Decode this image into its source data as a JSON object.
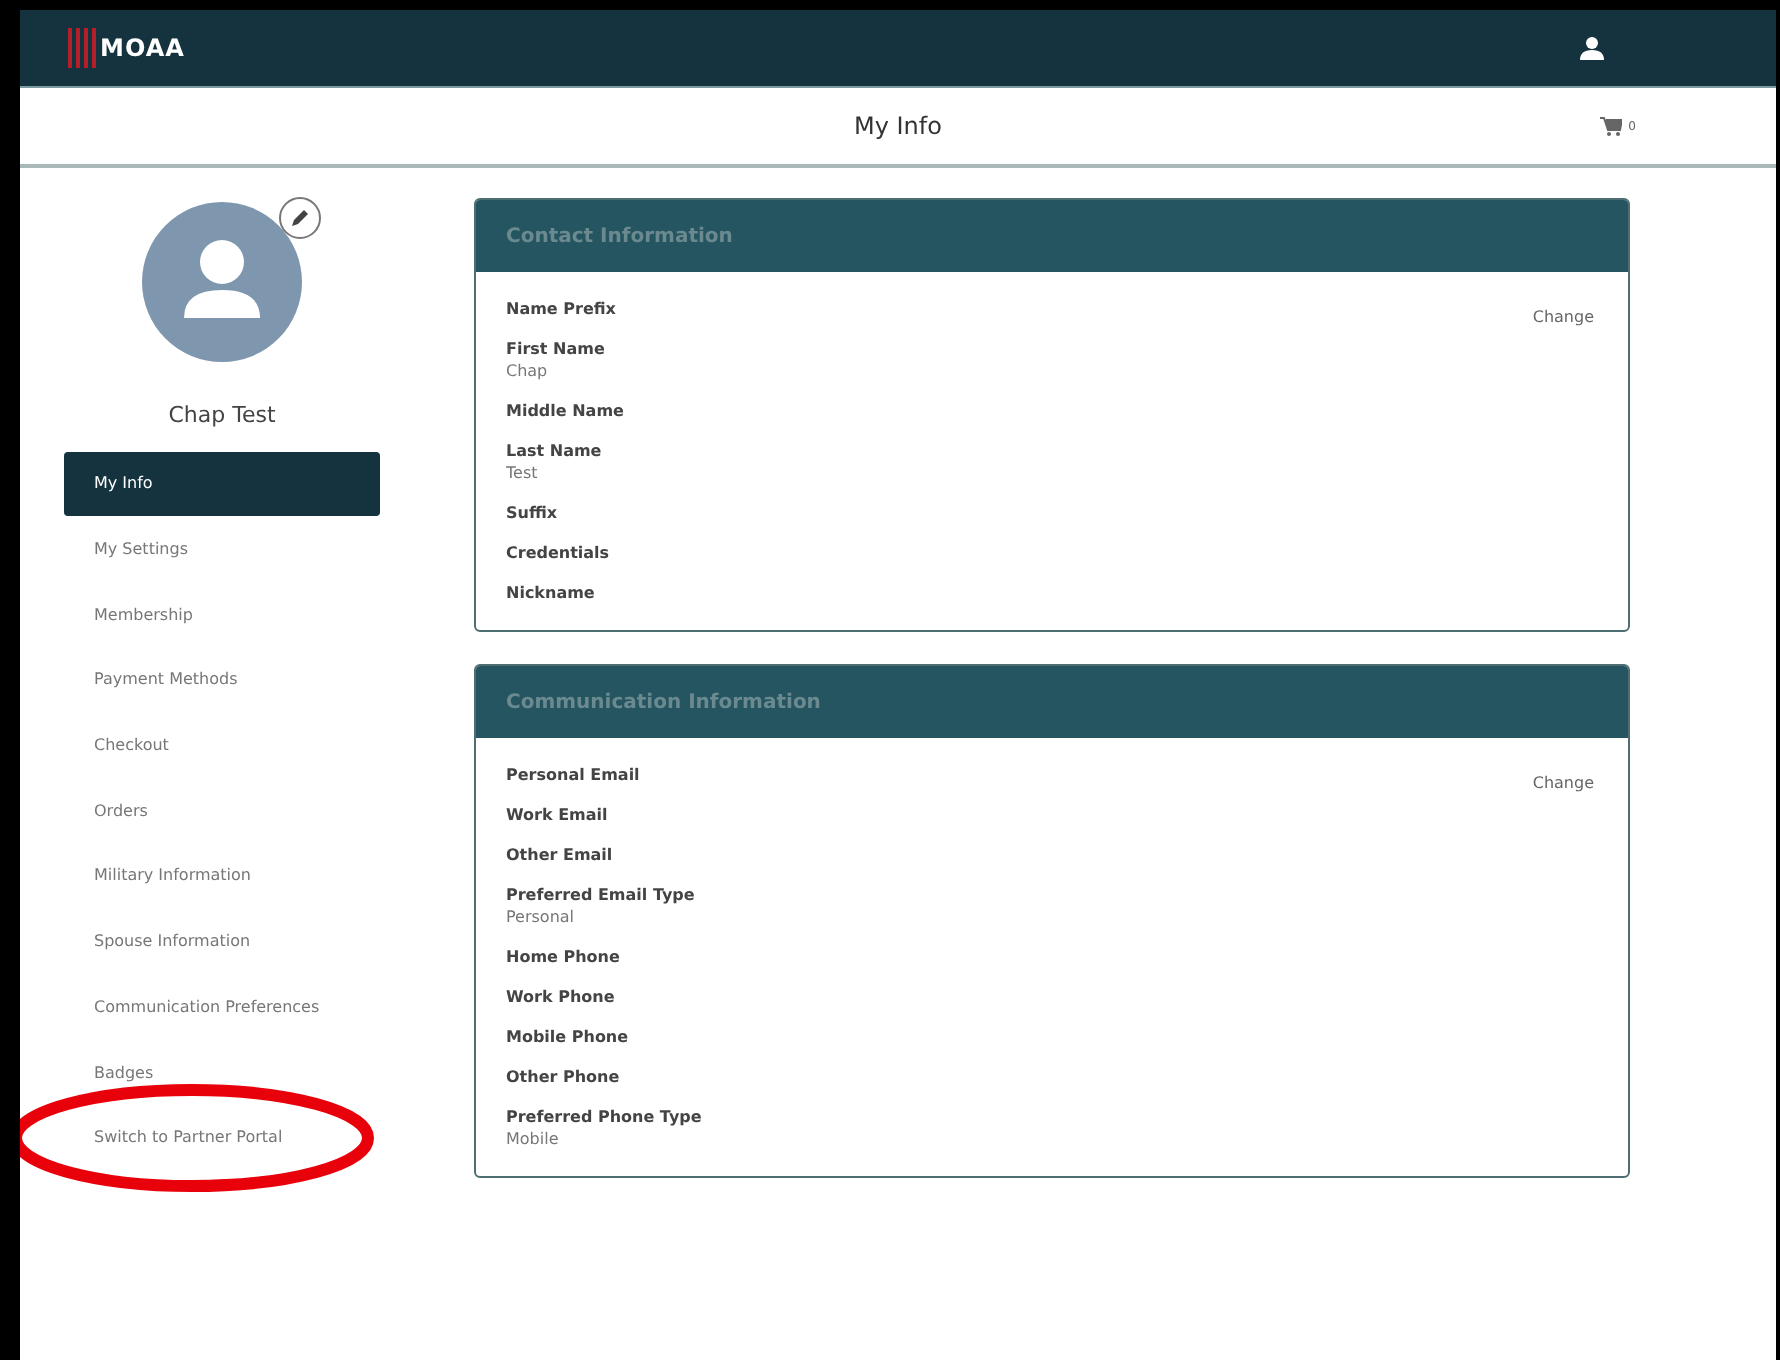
{
  "header": {
    "logo": "MOAA"
  },
  "subheader": {
    "title": "My Info",
    "cart_count": "0"
  },
  "profile": {
    "name": "Chap Test"
  },
  "sidebar": {
    "items": [
      {
        "label": "My Info",
        "selected": true
      },
      {
        "label": "My Settings",
        "selected": false
      },
      {
        "label": "Membership",
        "selected": false
      },
      {
        "label": "Payment Methods",
        "selected": false
      },
      {
        "label": "Checkout",
        "selected": false
      },
      {
        "label": "Orders",
        "selected": false
      },
      {
        "label": "Military Information",
        "selected": false
      },
      {
        "label": "Spouse Information",
        "selected": false
      },
      {
        "label": "Communication Preferences",
        "selected": false
      },
      {
        "label": "Badges",
        "selected": false
      },
      {
        "label": "Switch to Partner Portal",
        "selected": false,
        "circled": true
      }
    ]
  },
  "cards": [
    {
      "title": "Contact Information",
      "action": "Change",
      "fields": [
        {
          "label": "Name Prefix"
        },
        {
          "label": "First Name",
          "value": "Chap"
        },
        {
          "label": "Middle Name"
        },
        {
          "label": "Last Name",
          "value": "Test"
        },
        {
          "label": "Suffix"
        },
        {
          "label": "Credentials"
        },
        {
          "label": "Nickname"
        }
      ]
    },
    {
      "title": "Communication Information",
      "action": "Change",
      "fields": [
        {
          "label": "Personal Email"
        },
        {
          "label": "Work Email"
        },
        {
          "label": "Other Email"
        },
        {
          "label": "Preferred Email Type",
          "value": "Personal"
        },
        {
          "label": "Home Phone"
        },
        {
          "label": "Work Phone"
        },
        {
          "label": "Mobile Phone"
        },
        {
          "label": "Other Phone"
        },
        {
          "label": "Preferred Phone Type",
          "value": "Mobile"
        }
      ]
    }
  ]
}
